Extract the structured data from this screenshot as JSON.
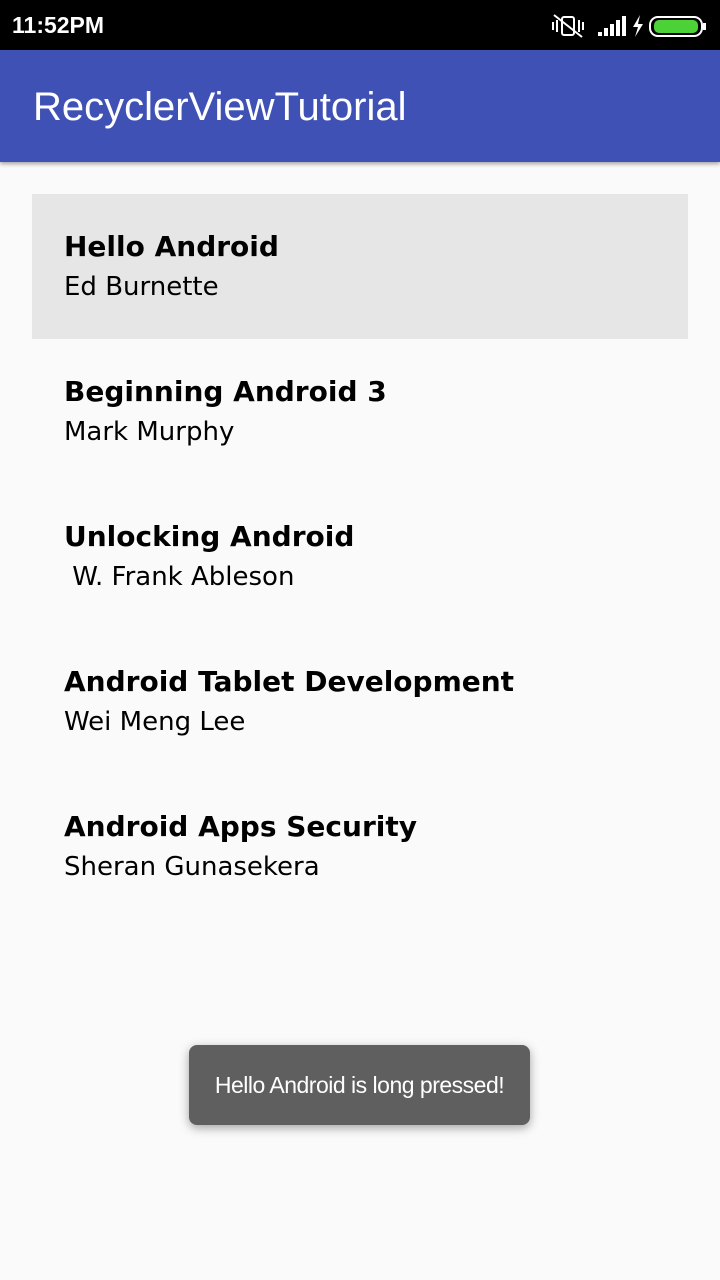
{
  "status_bar": {
    "time": "11:52PM",
    "icons": [
      "vibrate-off-icon",
      "signal-icon",
      "charging-icon",
      "battery-icon"
    ],
    "battery_color": "#4cd137"
  },
  "app_bar": {
    "title": "RecyclerViewTutorial",
    "color": "#3f51b5"
  },
  "books": [
    {
      "title": "Hello Android",
      "author": "Ed Burnette",
      "pressed": true
    },
    {
      "title": "Beginning Android 3",
      "author": "Mark Murphy",
      "pressed": false
    },
    {
      "title": "Unlocking Android",
      "author": " W. Frank Ableson",
      "pressed": false
    },
    {
      "title": "Android Tablet Development",
      "author": "Wei Meng Lee",
      "pressed": false
    },
    {
      "title": "Android Apps Security",
      "author": "Sheran Gunasekera",
      "pressed": false
    }
  ],
  "toast": {
    "message": "Hello Android is long pressed!"
  }
}
